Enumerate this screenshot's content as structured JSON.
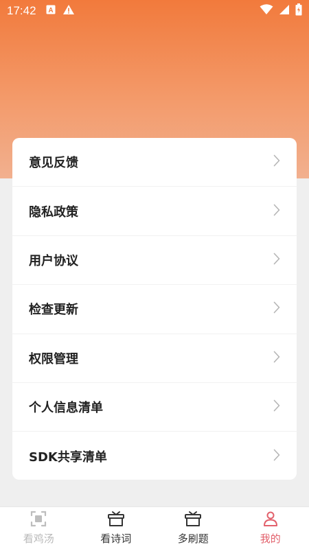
{
  "status_bar": {
    "time": "17:42",
    "left_icons": [
      "a-box-icon",
      "warning-icon"
    ],
    "right_icons": [
      "wifi-icon",
      "signal-icon",
      "battery-icon"
    ]
  },
  "colors": {
    "header_gradient_top": "#f27a3c",
    "header_gradient_bottom": "#f2b08f",
    "active_tab": "#e2606b",
    "disabled_tab": "#b9b9b9"
  },
  "menu": {
    "items": [
      {
        "label": "意见反馈"
      },
      {
        "label": "隐私政策"
      },
      {
        "label": "用户协议"
      },
      {
        "label": "检查更新"
      },
      {
        "label": "权限管理"
      },
      {
        "label": "个人信息清单"
      },
      {
        "label": "SDK共享清单"
      }
    ]
  },
  "tabbar": {
    "tabs": [
      {
        "label": "看鸡汤",
        "icon": "scan-frame-icon",
        "state": "disabled"
      },
      {
        "label": "看诗词",
        "icon": "gift-box-icon",
        "state": "normal"
      },
      {
        "label": "多刷题",
        "icon": "gift-box-icon",
        "state": "normal"
      },
      {
        "label": "我的",
        "icon": "user-icon",
        "state": "active"
      }
    ]
  }
}
